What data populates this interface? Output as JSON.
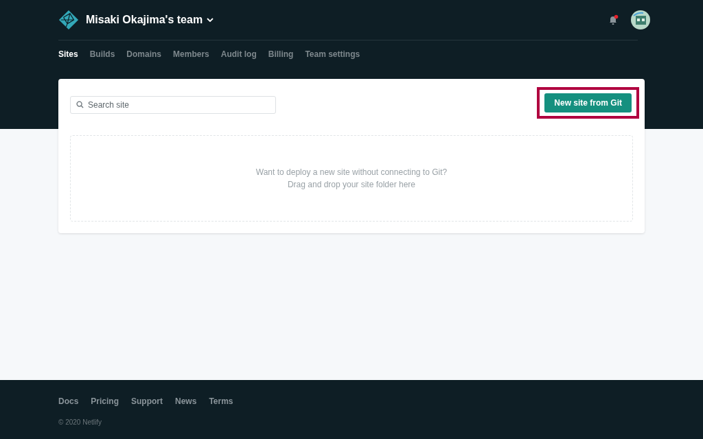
{
  "header": {
    "team_name": "Misaki Okajima's team",
    "notifications": {
      "unread": true
    }
  },
  "tabs": [
    {
      "label": "Sites",
      "selected": true
    },
    {
      "label": "Builds",
      "selected": false
    },
    {
      "label": "Domains",
      "selected": false
    },
    {
      "label": "Members",
      "selected": false
    },
    {
      "label": "Audit log",
      "selected": false
    },
    {
      "label": "Billing",
      "selected": false
    },
    {
      "label": "Team settings",
      "selected": false
    }
  ],
  "search": {
    "placeholder": "Search site"
  },
  "new_site_button": {
    "label": "New site from Git",
    "highlighted": true
  },
  "dropzone": {
    "lines": [
      "Want to deploy a new site without connecting to Git?",
      "Drag and drop your site folder here"
    ]
  },
  "footer": {
    "links": [
      "Docs",
      "Pricing",
      "Support",
      "News",
      "Terms"
    ],
    "copyright": "© 2020 Netlify"
  }
}
